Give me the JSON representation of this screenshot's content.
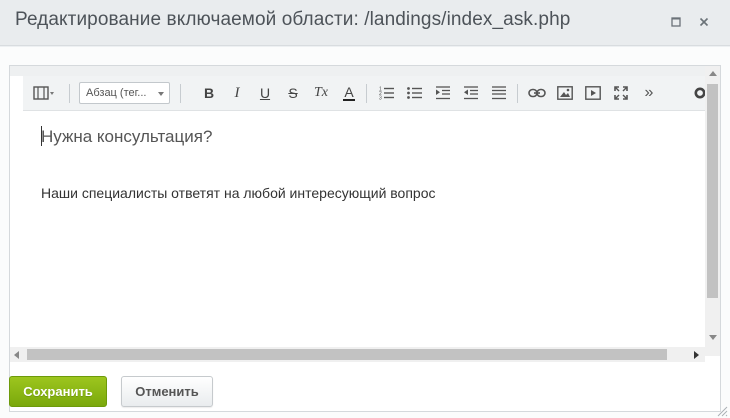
{
  "dialog": {
    "title": "Редактирование включаемой области: /landings/index_ask.php"
  },
  "toolbar": {
    "style_select_value": "Абзац (тег...",
    "buttons": [
      {
        "name": "view-mode-icon"
      },
      {
        "name": "bold-icon",
        "glyph": "B"
      },
      {
        "name": "italic-icon",
        "glyph": "I"
      },
      {
        "name": "underline-icon",
        "glyph": "U"
      },
      {
        "name": "strikethrough-icon",
        "glyph": "S"
      },
      {
        "name": "remove-format-icon",
        "glyph": "Tx"
      },
      {
        "name": "text-color-icon",
        "glyph": "A"
      },
      {
        "name": "ordered-list-icon"
      },
      {
        "name": "unordered-list-icon"
      },
      {
        "name": "outdent-icon"
      },
      {
        "name": "indent-icon"
      },
      {
        "name": "align-icon"
      },
      {
        "name": "link-icon"
      },
      {
        "name": "image-icon"
      },
      {
        "name": "video-icon"
      },
      {
        "name": "fullscreen-icon"
      },
      {
        "name": "more-icon",
        "glyph": "»"
      },
      {
        "name": "settings-icon"
      }
    ]
  },
  "content": {
    "heading": "Нужна консультация?",
    "paragraph": "Наши специалисты ответят на любой интересующий вопрос"
  },
  "actions": {
    "save_label": "Сохранить",
    "cancel_label": "Отменить"
  },
  "colors": {
    "save_green": "#8cb815",
    "titlebar_bg": "#e9ecee",
    "title_text": "#4d5359"
  }
}
